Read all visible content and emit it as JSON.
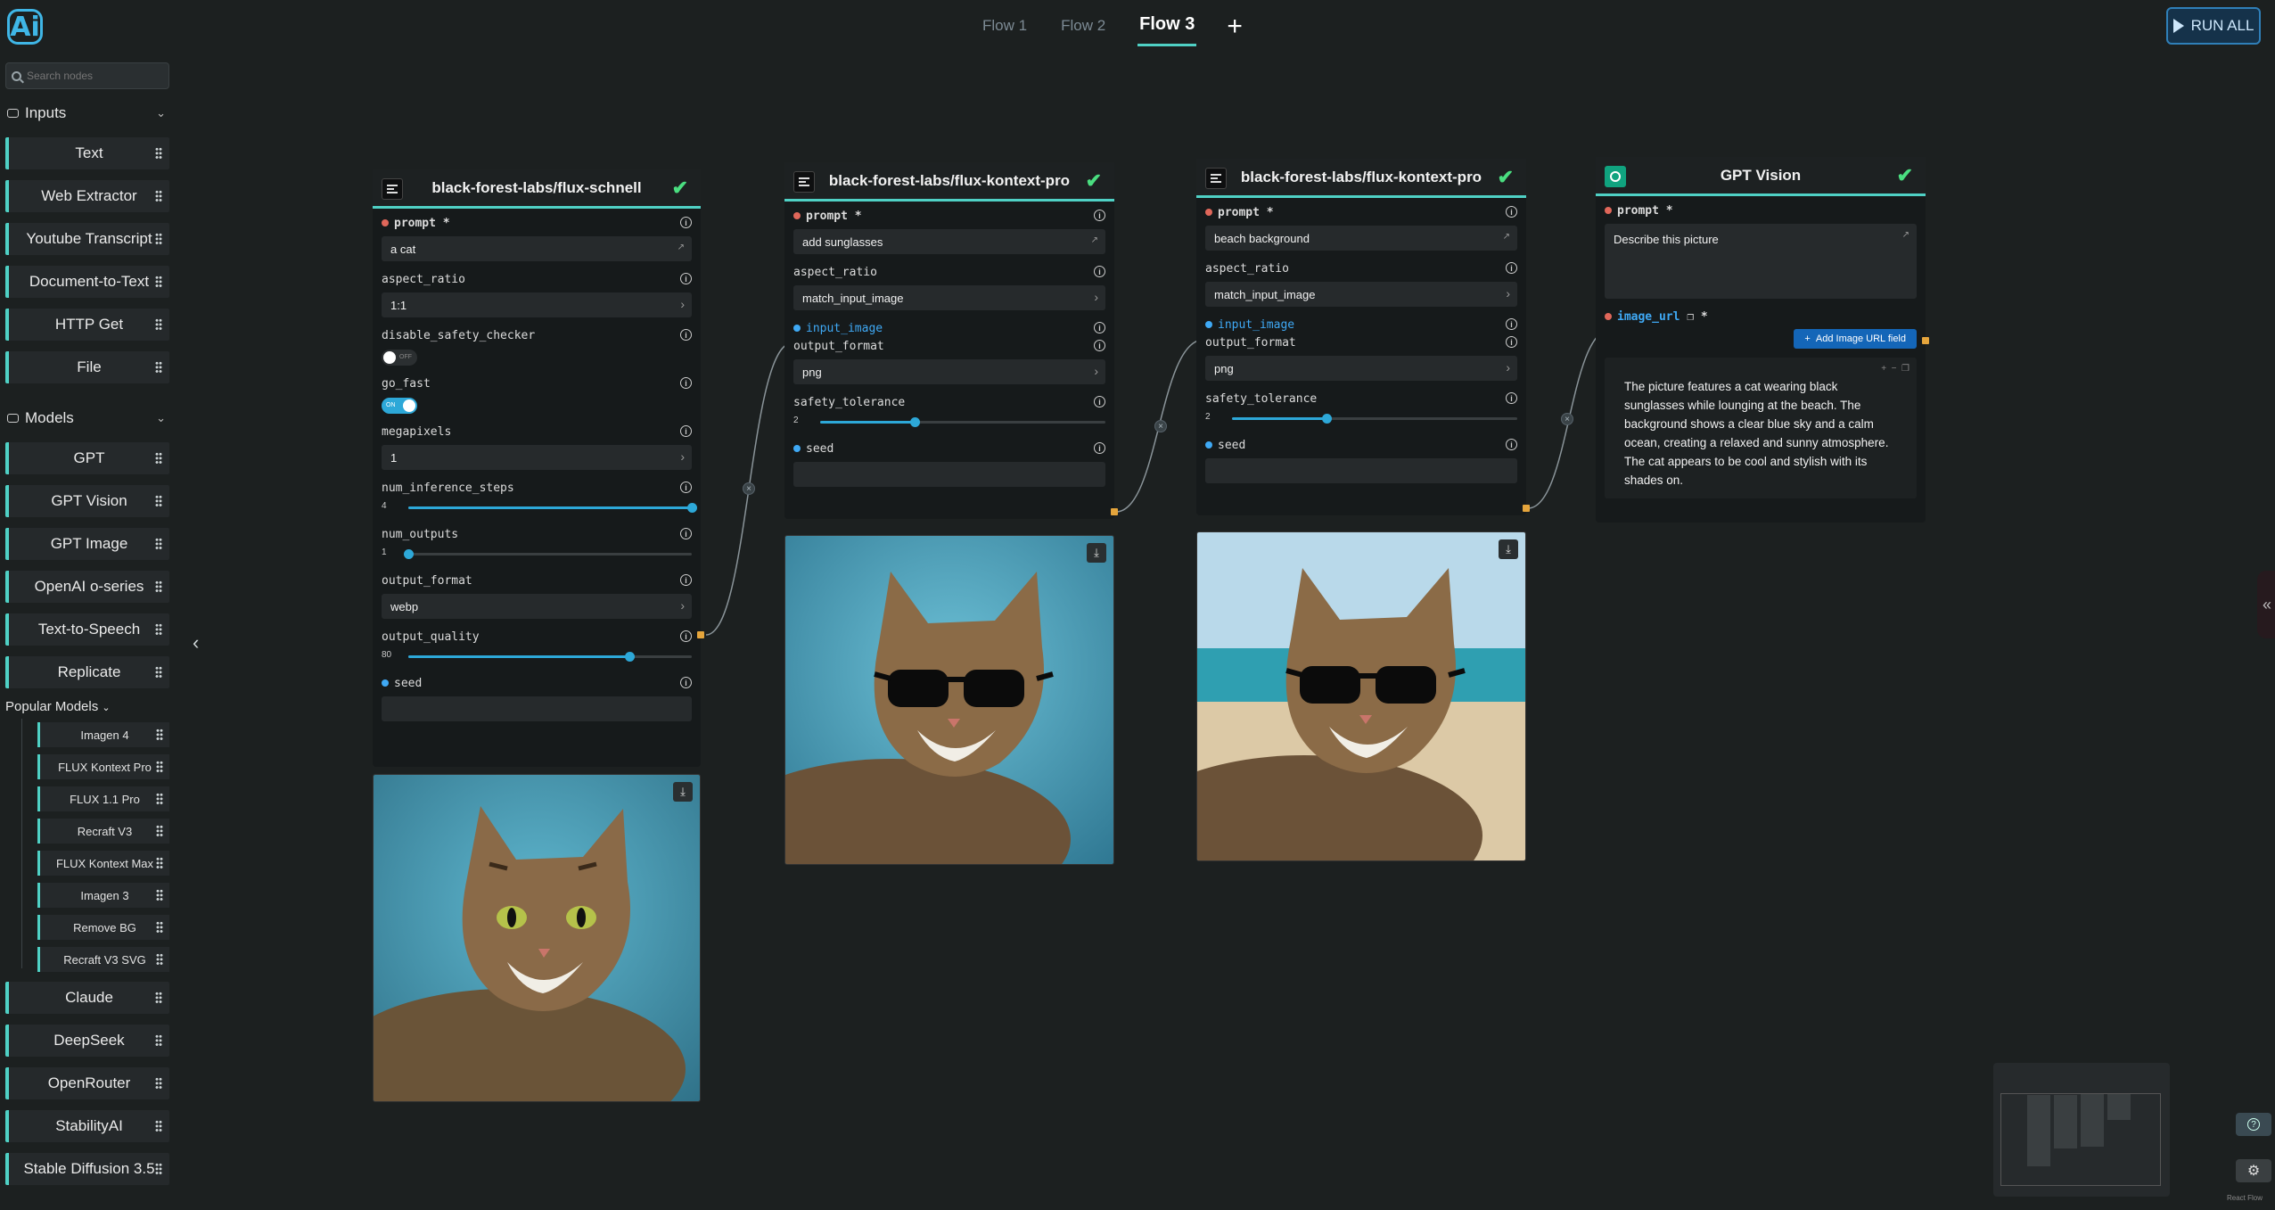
{
  "top": {
    "tabs": [
      "Flow 1",
      "Flow 2",
      "Flow 3"
    ],
    "add_tab": "+",
    "run_all": "RUN ALL"
  },
  "sidebar": {
    "search_placeholder": "Search nodes",
    "inputs_label": "Inputs",
    "inputs": [
      "Text",
      "Web Extractor",
      "Youtube Transcript",
      "Document-to-Text",
      "HTTP Get",
      "File"
    ],
    "models_label": "Models",
    "models": [
      "GPT",
      "GPT Vision",
      "GPT Image",
      "OpenAI o-series",
      "Text-to-Speech",
      "Replicate"
    ],
    "popular_label": "Popular Models",
    "popular": [
      "Imagen 4",
      "FLUX Kontext Pro",
      "FLUX 1.1 Pro",
      "Recraft V3",
      "FLUX Kontext Max",
      "Imagen 3",
      "Remove BG",
      "Recraft V3 SVG"
    ],
    "more": [
      "Claude",
      "DeepSeek",
      "OpenRouter",
      "StabilityAI",
      "Stable Diffusion 3.5"
    ]
  },
  "node1": {
    "title": "black-forest-labs/flux-schnell",
    "prompt_label": "prompt",
    "prompt_value": "a cat",
    "aspect_label": "aspect_ratio",
    "aspect_value": "1:1",
    "safety_label": "disable_safety_checker",
    "safety_state": "OFF",
    "fast_label": "go_fast",
    "fast_state": "ON",
    "mp_label": "megapixels",
    "mp_value": "1",
    "steps_label": "num_inference_steps",
    "steps_value": "4",
    "steps_fraction": 1.0,
    "outputs_label": "num_outputs",
    "outputs_value": "1",
    "outputs_fraction": 0.0,
    "format_label": "output_format",
    "format_value": "webp",
    "quality_label": "output_quality",
    "quality_value": "80",
    "quality_fraction": 0.78,
    "seed_label": "seed"
  },
  "node2": {
    "title": "black-forest-labs/flux-kontext-pro",
    "prompt_label": "prompt",
    "prompt_value": "add sunglasses",
    "aspect_label": "aspect_ratio",
    "aspect_value": "match_input_image",
    "input_label": "input_image",
    "format_label": "output_format",
    "format_value": "png",
    "tol_label": "safety_tolerance",
    "tol_value": "2",
    "tol_fraction": 0.33,
    "seed_label": "seed"
  },
  "node3": {
    "title": "black-forest-labs/flux-kontext-pro",
    "prompt_label": "prompt",
    "prompt_value": "beach background",
    "aspect_label": "aspect_ratio",
    "aspect_value": "match_input_image",
    "input_label": "input_image",
    "format_label": "output_format",
    "format_value": "png",
    "tol_label": "safety_tolerance",
    "tol_value": "2",
    "tol_fraction": 0.33,
    "seed_label": "seed"
  },
  "node4": {
    "title": "GPT Vision",
    "prompt_label": "prompt",
    "prompt_value": "Describe this picture",
    "url_label": "image_url",
    "add_url": "Add Image URL field",
    "response": "The picture features a cat wearing black sunglasses while lounging at the beach. The background shows a clear blue sky and a calm ocean, creating a relaxed and sunny atmosphere. The cat appears to be cool and stylish with its shades on."
  },
  "footer": {
    "react_flow": "React Flow"
  },
  "colors": {
    "accent": "#4fd1c5",
    "required": "#e0675a",
    "connected": "#3fa9f5",
    "handle": "#e5a53c",
    "ok": "#4ade80"
  }
}
